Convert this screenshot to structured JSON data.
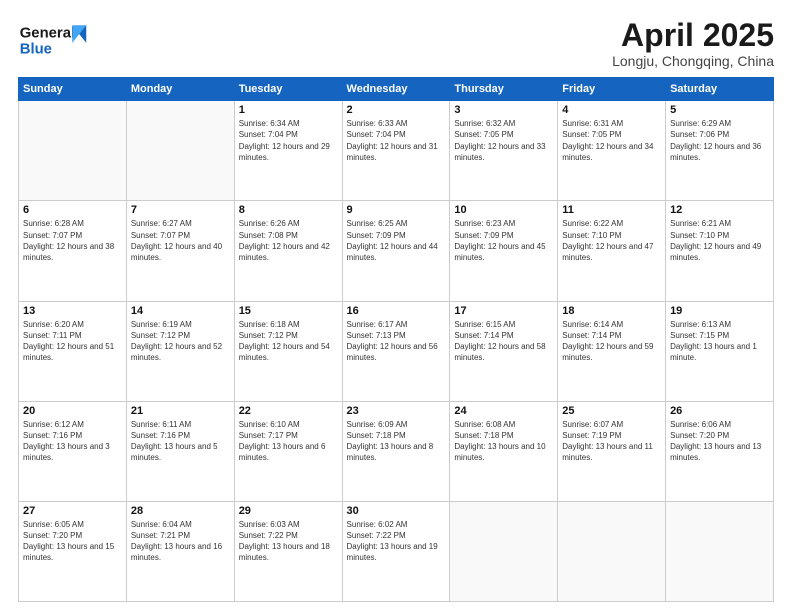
{
  "header": {
    "logo_line1": "General",
    "logo_line2": "Blue",
    "month_title": "April 2025",
    "location": "Longju, Chongqing, China"
  },
  "calendar": {
    "days_of_week": [
      "Sunday",
      "Monday",
      "Tuesday",
      "Wednesday",
      "Thursday",
      "Friday",
      "Saturday"
    ],
    "weeks": [
      [
        {
          "day": "",
          "sunrise": "",
          "sunset": "",
          "daylight": ""
        },
        {
          "day": "",
          "sunrise": "",
          "sunset": "",
          "daylight": ""
        },
        {
          "day": "1",
          "sunrise": "Sunrise: 6:34 AM",
          "sunset": "Sunset: 7:04 PM",
          "daylight": "Daylight: 12 hours and 29 minutes."
        },
        {
          "day": "2",
          "sunrise": "Sunrise: 6:33 AM",
          "sunset": "Sunset: 7:04 PM",
          "daylight": "Daylight: 12 hours and 31 minutes."
        },
        {
          "day": "3",
          "sunrise": "Sunrise: 6:32 AM",
          "sunset": "Sunset: 7:05 PM",
          "daylight": "Daylight: 12 hours and 33 minutes."
        },
        {
          "day": "4",
          "sunrise": "Sunrise: 6:31 AM",
          "sunset": "Sunset: 7:05 PM",
          "daylight": "Daylight: 12 hours and 34 minutes."
        },
        {
          "day": "5",
          "sunrise": "Sunrise: 6:29 AM",
          "sunset": "Sunset: 7:06 PM",
          "daylight": "Daylight: 12 hours and 36 minutes."
        }
      ],
      [
        {
          "day": "6",
          "sunrise": "Sunrise: 6:28 AM",
          "sunset": "Sunset: 7:07 PM",
          "daylight": "Daylight: 12 hours and 38 minutes."
        },
        {
          "day": "7",
          "sunrise": "Sunrise: 6:27 AM",
          "sunset": "Sunset: 7:07 PM",
          "daylight": "Daylight: 12 hours and 40 minutes."
        },
        {
          "day": "8",
          "sunrise": "Sunrise: 6:26 AM",
          "sunset": "Sunset: 7:08 PM",
          "daylight": "Daylight: 12 hours and 42 minutes."
        },
        {
          "day": "9",
          "sunrise": "Sunrise: 6:25 AM",
          "sunset": "Sunset: 7:09 PM",
          "daylight": "Daylight: 12 hours and 44 minutes."
        },
        {
          "day": "10",
          "sunrise": "Sunrise: 6:23 AM",
          "sunset": "Sunset: 7:09 PM",
          "daylight": "Daylight: 12 hours and 45 minutes."
        },
        {
          "day": "11",
          "sunrise": "Sunrise: 6:22 AM",
          "sunset": "Sunset: 7:10 PM",
          "daylight": "Daylight: 12 hours and 47 minutes."
        },
        {
          "day": "12",
          "sunrise": "Sunrise: 6:21 AM",
          "sunset": "Sunset: 7:10 PM",
          "daylight": "Daylight: 12 hours and 49 minutes."
        }
      ],
      [
        {
          "day": "13",
          "sunrise": "Sunrise: 6:20 AM",
          "sunset": "Sunset: 7:11 PM",
          "daylight": "Daylight: 12 hours and 51 minutes."
        },
        {
          "day": "14",
          "sunrise": "Sunrise: 6:19 AM",
          "sunset": "Sunset: 7:12 PM",
          "daylight": "Daylight: 12 hours and 52 minutes."
        },
        {
          "day": "15",
          "sunrise": "Sunrise: 6:18 AM",
          "sunset": "Sunset: 7:12 PM",
          "daylight": "Daylight: 12 hours and 54 minutes."
        },
        {
          "day": "16",
          "sunrise": "Sunrise: 6:17 AM",
          "sunset": "Sunset: 7:13 PM",
          "daylight": "Daylight: 12 hours and 56 minutes."
        },
        {
          "day": "17",
          "sunrise": "Sunrise: 6:15 AM",
          "sunset": "Sunset: 7:14 PM",
          "daylight": "Daylight: 12 hours and 58 minutes."
        },
        {
          "day": "18",
          "sunrise": "Sunrise: 6:14 AM",
          "sunset": "Sunset: 7:14 PM",
          "daylight": "Daylight: 12 hours and 59 minutes."
        },
        {
          "day": "19",
          "sunrise": "Sunrise: 6:13 AM",
          "sunset": "Sunset: 7:15 PM",
          "daylight": "Daylight: 13 hours and 1 minute."
        }
      ],
      [
        {
          "day": "20",
          "sunrise": "Sunrise: 6:12 AM",
          "sunset": "Sunset: 7:16 PM",
          "daylight": "Daylight: 13 hours and 3 minutes."
        },
        {
          "day": "21",
          "sunrise": "Sunrise: 6:11 AM",
          "sunset": "Sunset: 7:16 PM",
          "daylight": "Daylight: 13 hours and 5 minutes."
        },
        {
          "day": "22",
          "sunrise": "Sunrise: 6:10 AM",
          "sunset": "Sunset: 7:17 PM",
          "daylight": "Daylight: 13 hours and 6 minutes."
        },
        {
          "day": "23",
          "sunrise": "Sunrise: 6:09 AM",
          "sunset": "Sunset: 7:18 PM",
          "daylight": "Daylight: 13 hours and 8 minutes."
        },
        {
          "day": "24",
          "sunrise": "Sunrise: 6:08 AM",
          "sunset": "Sunset: 7:18 PM",
          "daylight": "Daylight: 13 hours and 10 minutes."
        },
        {
          "day": "25",
          "sunrise": "Sunrise: 6:07 AM",
          "sunset": "Sunset: 7:19 PM",
          "daylight": "Daylight: 13 hours and 11 minutes."
        },
        {
          "day": "26",
          "sunrise": "Sunrise: 6:06 AM",
          "sunset": "Sunset: 7:20 PM",
          "daylight": "Daylight: 13 hours and 13 minutes."
        }
      ],
      [
        {
          "day": "27",
          "sunrise": "Sunrise: 6:05 AM",
          "sunset": "Sunset: 7:20 PM",
          "daylight": "Daylight: 13 hours and 15 minutes."
        },
        {
          "day": "28",
          "sunrise": "Sunrise: 6:04 AM",
          "sunset": "Sunset: 7:21 PM",
          "daylight": "Daylight: 13 hours and 16 minutes."
        },
        {
          "day": "29",
          "sunrise": "Sunrise: 6:03 AM",
          "sunset": "Sunset: 7:22 PM",
          "daylight": "Daylight: 13 hours and 18 minutes."
        },
        {
          "day": "30",
          "sunrise": "Sunrise: 6:02 AM",
          "sunset": "Sunset: 7:22 PM",
          "daylight": "Daylight: 13 hours and 19 minutes."
        },
        {
          "day": "",
          "sunrise": "",
          "sunset": "",
          "daylight": ""
        },
        {
          "day": "",
          "sunrise": "",
          "sunset": "",
          "daylight": ""
        },
        {
          "day": "",
          "sunrise": "",
          "sunset": "",
          "daylight": ""
        }
      ]
    ]
  }
}
